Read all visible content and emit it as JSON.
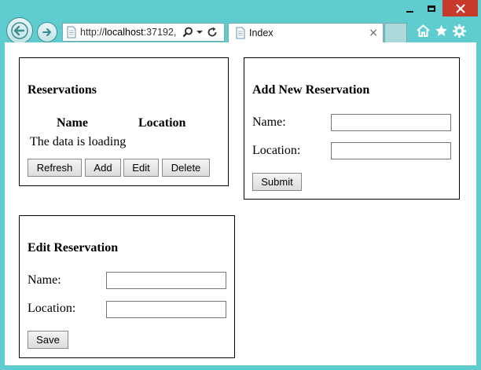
{
  "browser": {
    "url_prefix": "http://",
    "url_host": "localhost",
    "url_port": ":37192,",
    "tab_title": "Index",
    "tab_close": "×"
  },
  "reservations": {
    "title": "Reservations",
    "columns": [
      "Name",
      "Location"
    ],
    "loading_text": "The data is loading",
    "buttons": {
      "refresh": "Refresh",
      "add": "Add",
      "edit": "Edit",
      "delete": "Delete"
    }
  },
  "add_form": {
    "title": "Add New Reservation",
    "name_label": "Name:",
    "location_label": "Location:",
    "name_value": "",
    "location_value": "",
    "submit": "Submit"
  },
  "edit_form": {
    "title": "Edit Reservation",
    "name_label": "Name:",
    "location_label": "Location:",
    "name_value": "",
    "location_value": "",
    "save": "Save"
  },
  "colors": {
    "chrome": "#5fcccf",
    "close_button": "#c7392b"
  },
  "icons": [
    "back-arrow-icon",
    "forward-arrow-icon",
    "page-icon",
    "search-icon",
    "dropdown-icon",
    "refresh-icon",
    "home-icon",
    "favorites-star-icon",
    "settings-gear-icon"
  ]
}
